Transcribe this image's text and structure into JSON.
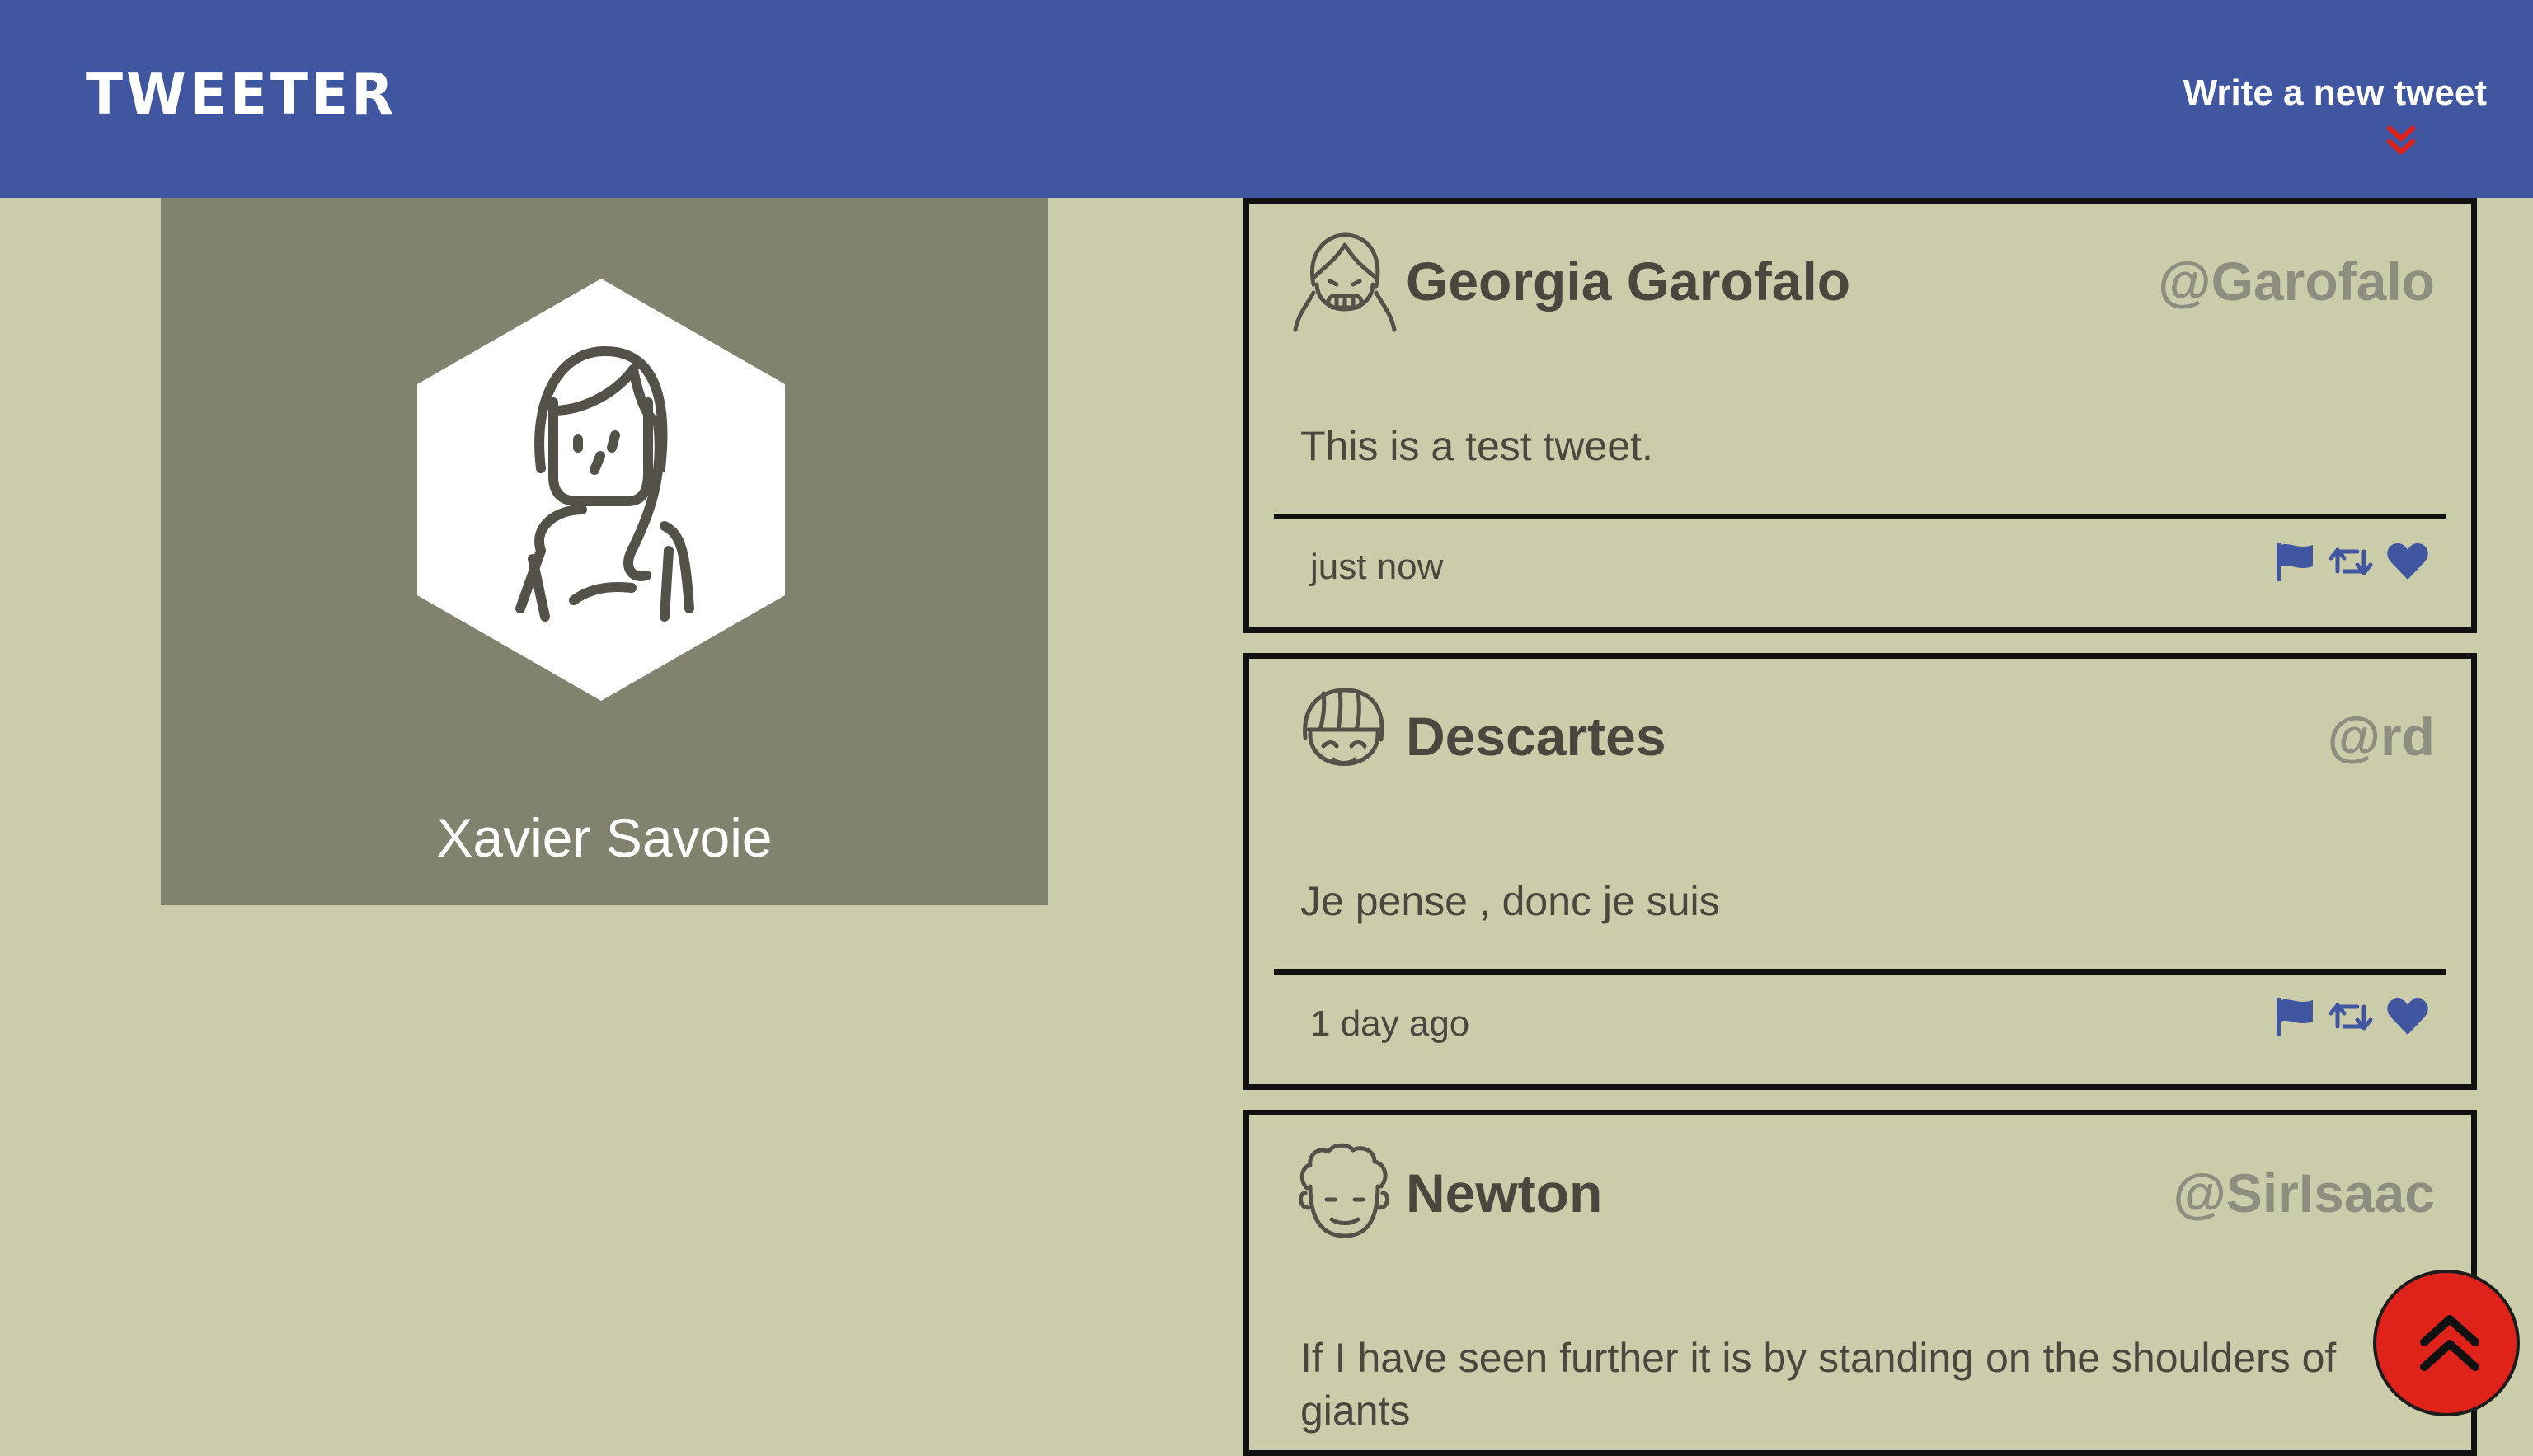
{
  "nav": {
    "brand": "TWEETER",
    "compose_label": "Write a new tweet"
  },
  "profile": {
    "name": "Xavier Savoie"
  },
  "tweets": [
    {
      "name": "Georgia Garofalo",
      "handle": "@Garofalo",
      "text": "This is a test tweet.",
      "time": "just now"
    },
    {
      "name": "Descartes",
      "handle": "@rd",
      "text": "Je pense , donc je suis",
      "time": "1 day ago"
    },
    {
      "name": "Newton",
      "handle": "@SirIsaac",
      "text": "If I have seen further it is by standing on the shoulders of giants",
      "time": ""
    }
  ],
  "icons": {
    "flag": "flag-icon",
    "retweet": "retweet-icon",
    "like": "heart-icon",
    "compose_chevron": "double-chevron-down-icon",
    "scroll_top": "double-chevron-up-icon"
  },
  "colors": {
    "nav_background": "#4056a1",
    "page_background": "#cbcca9",
    "profile_background": "#82836f",
    "action_icon": "#4056a1",
    "chevron_accent": "#e0231a",
    "scroll_button": "#e0231a"
  }
}
